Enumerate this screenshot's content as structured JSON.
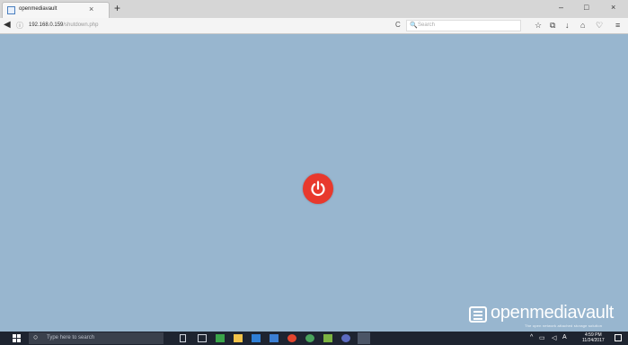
{
  "browser": {
    "tab_title": "openmediavault",
    "tab_close": "×",
    "new_tab": "+",
    "back_glyph": "◀",
    "info_glyph": "ⓘ",
    "url_host": "192.168.0.159",
    "url_path": "/shutdown.php",
    "reload_glyph": "C",
    "search_glyph": "🔍",
    "search_placeholder": "Search",
    "bookmark_glyph": "☆",
    "library_glyph": "⧉",
    "download_glyph": "↓",
    "home_glyph": "⌂",
    "pocket_glyph": "♡",
    "menu_glyph": "≡",
    "minimize": "–",
    "maximize": "□",
    "close": "×"
  },
  "page": {
    "background": "#98b6cf",
    "power_color": "#e8392d",
    "brand_name": "openmediavault",
    "brand_tagline": "The open network attached storage solution"
  },
  "taskbar": {
    "search_glyph": "○",
    "search_placeholder": "Type here to search",
    "tray_chevron": "^",
    "tray_network": "▭",
    "tray_volume": "◁",
    "tray_lang": "A",
    "time": "4:59 PM",
    "date": "11/24/2017"
  }
}
